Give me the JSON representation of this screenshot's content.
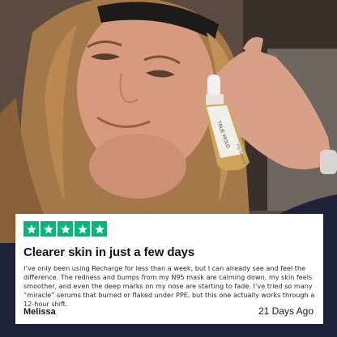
{
  "photo": {
    "bottle_label_brand": "TRUE MOLD",
    "bottle_label_small": "my beauty"
  },
  "review": {
    "rating_stars": 5,
    "star_color": "#00b67a",
    "headline": "Clearer skin in just a few days",
    "body": "I’ve only been using Recharge for less than a week, but I can already see and feel the difference. The redness and bumps from my N95 mask are calming down, my skin feels smoother, and even the deep marks on my nose are starting to fade. I’ve tried so many “miracle” serums that burned or flaked under PPE, but this one actually works through a 12-hour shift.",
    "reviewer": "Melissa",
    "date": "21 Days Ago"
  }
}
